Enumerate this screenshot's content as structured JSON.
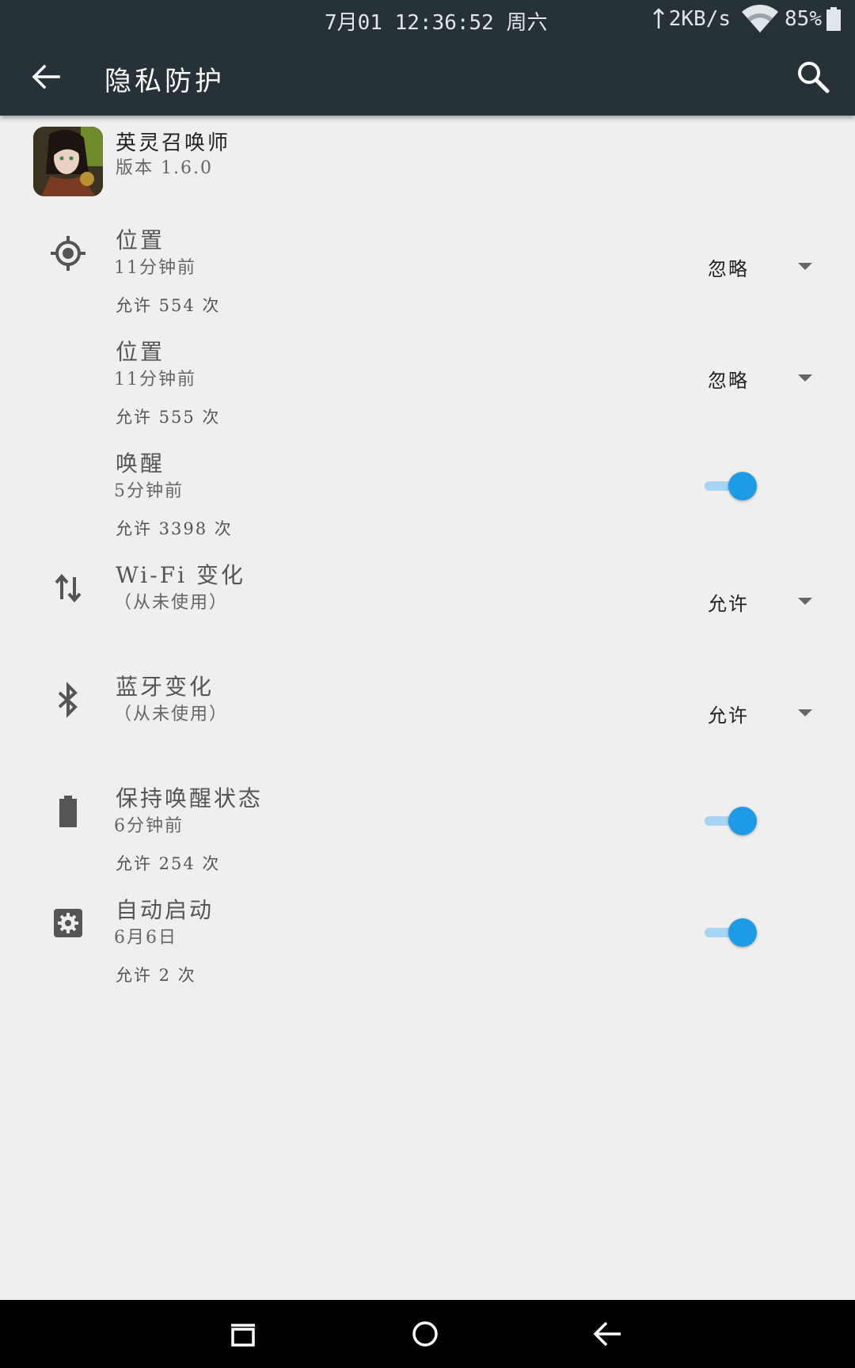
{
  "status_bar": {
    "datetime": "7月01 12:36:52 周六",
    "net_speed": "2KB/s",
    "battery": "85%",
    "icons": [
      "upload-arrow-icon",
      "wifi-icon",
      "battery-icon"
    ]
  },
  "app_bar": {
    "title": "隐私防护",
    "icons": [
      "back-arrow-icon",
      "search-icon"
    ],
    "background": "#263238"
  },
  "app": {
    "name": "英灵召唤师",
    "version": "版本 1.6.0"
  },
  "permissions": [
    {
      "icon": "location-icon",
      "label": "位置",
      "time": "11分钟前",
      "count": "允许 554 次",
      "control": "dropdown",
      "value": "忽略"
    },
    {
      "icon": "",
      "label": "位置",
      "time": "11分钟前",
      "count": "允许 555 次",
      "control": "dropdown",
      "value": "忽略"
    },
    {
      "icon": "",
      "label": "唤醒",
      "time": "5分钟前",
      "count": "允许 3398 次",
      "control": "toggle",
      "on": true
    },
    {
      "icon": "swap-vertical-icon",
      "label": "Wi-Fi 变化",
      "time": "（从未使用）",
      "count": "",
      "control": "dropdown",
      "value": "允许"
    },
    {
      "icon": "bluetooth-icon",
      "label": "蓝牙变化",
      "time": "（从未使用）",
      "count": "",
      "control": "dropdown",
      "value": "允许"
    },
    {
      "icon": "battery-icon",
      "label": "保持唤醒状态",
      "time": "6分钟前",
      "count": "允许 254 次",
      "control": "toggle",
      "on": true
    },
    {
      "icon": "settings-box-icon",
      "label": "自动启动",
      "time": "6月6日",
      "count": "允许 2 次",
      "control": "toggle",
      "on": true
    }
  ],
  "nav_bar": {
    "icons": [
      "recents-icon",
      "home-icon",
      "back-icon"
    ]
  },
  "colors": {
    "accent": "#1e9be7",
    "toggle_track": "#a7d4f3",
    "background": "#efefef"
  }
}
